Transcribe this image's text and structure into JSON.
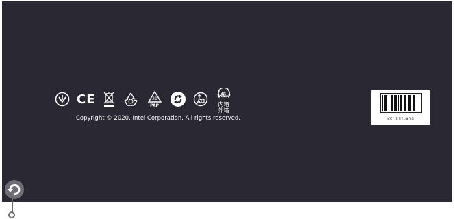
{
  "panel": {
    "background_color": "#2a2833"
  },
  "cert_marks": {
    "ce": "CE",
    "pap_code": "21",
    "pap_label": "PAP",
    "paper_char_top": "紙",
    "paper_text_line1": "内箱",
    "paper_text_line2": "外箱",
    "icons": [
      "plug-safety-icon",
      "ce-mark-icon",
      "weee-bin-icon",
      "recycle-arrows-icon",
      "pap-recycle-icon",
      "green-dot-icon",
      "tidyman-icon",
      "paper-recycle-icon"
    ]
  },
  "copyright": {
    "text": "Copyright © 2020, Intel Corporation. All rights reserved."
  },
  "barcode": {
    "number": "K91111-001"
  },
  "hotspot": {
    "icon": "rotate-icon"
  }
}
